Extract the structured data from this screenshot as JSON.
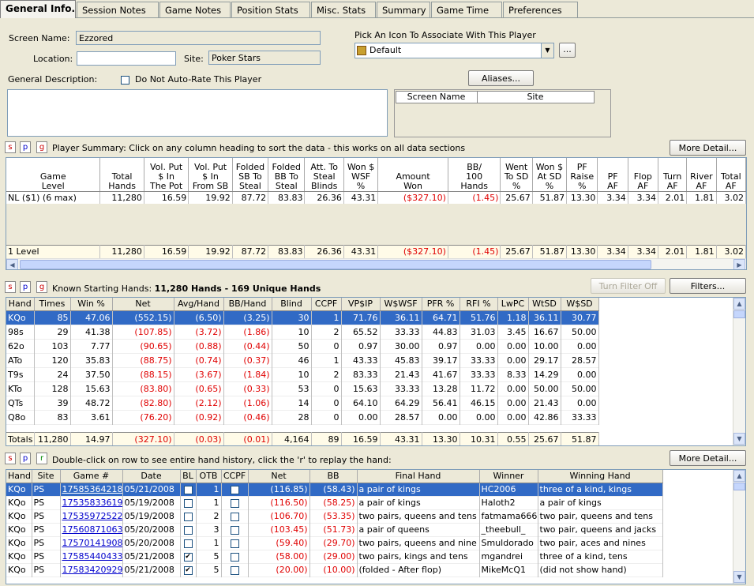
{
  "tabs": [
    {
      "label": "General Info.",
      "active": true
    },
    {
      "label": "Session Notes"
    },
    {
      "label": "Game Notes"
    },
    {
      "label": "Position Stats"
    },
    {
      "label": "Misc. Stats"
    },
    {
      "label": "Summary"
    },
    {
      "label": "Game Time"
    },
    {
      "label": "Preferences"
    }
  ],
  "form": {
    "screen_name_label": "Screen Name:",
    "screen_name": "Ezzored",
    "location_label": "Location:",
    "location": "",
    "site_label": "Site:",
    "site": "Poker Stars",
    "icon_label": "Pick An Icon To Associate With This Player",
    "icon_value": "Default",
    "icon_browse": "...",
    "desc_label": "General Description:",
    "no_autorate_label": "Do Not Auto-Rate This Player",
    "aliases_button": "Aliases...",
    "aliases_headers": [
      "Screen Name",
      "Site"
    ]
  },
  "summary": {
    "filter_s": "s",
    "filter_p": "p",
    "filter_g": "g",
    "title": "Player Summary: Click on any column heading to sort the data - this works on all data sections",
    "more_button": "More Detail...",
    "headers": [
      "Game\nLevel",
      "Total\nHands",
      "Vol. Put\n$ In\nThe Pot",
      "Vol. Put\n$ In\nFrom SB",
      "Folded\nSB To\nSteal",
      "Folded\nBB To\nSteal",
      "Att. To\nSteal\nBlinds",
      "Won $\nWSF\n%",
      "Amount\nWon",
      "BB/\n100\nHands",
      "Went\nTo SD\n%",
      "Won $\nAt SD\n%",
      "PF\nRaise\n%",
      "PF\nAF",
      "Flop\nAF",
      "Turn\nAF",
      "River\nAF",
      "Total\nAF"
    ],
    "rows": [
      [
        "NL ($1) (6 max)",
        "11,280",
        "16.59",
        "19.92",
        "87.72",
        "83.83",
        "26.36",
        "43.31",
        "($327.10)",
        "(1.45)",
        "25.67",
        "51.87",
        "13.30",
        "3.34",
        "3.34",
        "2.01",
        "1.81",
        "3.02"
      ]
    ],
    "total_row": [
      "1 Level",
      "11,280",
      "16.59",
      "19.92",
      "87.72",
      "83.83",
      "26.36",
      "43.31",
      "($327.10)",
      "(1.45)",
      "25.67",
      "51.87",
      "13.30",
      "3.34",
      "3.34",
      "2.01",
      "1.81",
      "3.02"
    ]
  },
  "hands": {
    "filter_s": "s",
    "filter_p": "p",
    "filter_g": "g",
    "title_prefix": "Known Starting Hands: ",
    "title_bold": "11,280 Hands - 169 Unique Hands",
    "turn_filter_button": "Turn Filter Off",
    "filters_button": "Filters...",
    "headers": [
      "Hand",
      "Times",
      "Win %",
      "Net",
      "Avg/Hand",
      "BB/Hand",
      "Blind",
      "CCPF",
      "VP$IP",
      "W$WSF",
      "PFR %",
      "RFI %",
      "LwPC",
      "WtSD",
      "W$SD"
    ],
    "rows": [
      [
        "KQo",
        "85",
        "47.06",
        "(552.15)",
        "(6.50)",
        "(3.25)",
        "30",
        "1",
        "71.76",
        "36.11",
        "64.71",
        "51.76",
        "1.18",
        "36.11",
        "30.77"
      ],
      [
        "98s",
        "29",
        "41.38",
        "(107.85)",
        "(3.72)",
        "(1.86)",
        "10",
        "2",
        "65.52",
        "33.33",
        "44.83",
        "31.03",
        "3.45",
        "16.67",
        "50.00"
      ],
      [
        "62o",
        "103",
        "7.77",
        "(90.65)",
        "(0.88)",
        "(0.44)",
        "50",
        "0",
        "0.97",
        "30.00",
        "0.97",
        "0.00",
        "0.00",
        "10.00",
        "0.00"
      ],
      [
        "ATo",
        "120",
        "35.83",
        "(88.75)",
        "(0.74)",
        "(0.37)",
        "46",
        "1",
        "43.33",
        "45.83",
        "39.17",
        "33.33",
        "0.00",
        "29.17",
        "28.57"
      ],
      [
        "T9s",
        "24",
        "37.50",
        "(88.15)",
        "(3.67)",
        "(1.84)",
        "10",
        "2",
        "83.33",
        "21.43",
        "41.67",
        "33.33",
        "8.33",
        "14.29",
        "0.00"
      ],
      [
        "KTo",
        "128",
        "15.63",
        "(83.80)",
        "(0.65)",
        "(0.33)",
        "53",
        "0",
        "15.63",
        "33.33",
        "13.28",
        "11.72",
        "0.00",
        "50.00",
        "50.00"
      ],
      [
        "QTs",
        "39",
        "48.72",
        "(82.80)",
        "(2.12)",
        "(1.06)",
        "14",
        "0",
        "64.10",
        "64.29",
        "56.41",
        "46.15",
        "0.00",
        "21.43",
        "0.00"
      ],
      [
        "Q8o",
        "83",
        "3.61",
        "(76.20)",
        "(0.92)",
        "(0.46)",
        "28",
        "0",
        "0.00",
        "28.57",
        "0.00",
        "0.00",
        "0.00",
        "42.86",
        "33.33"
      ]
    ],
    "total_row": [
      "Totals",
      "11,280",
      "14.97",
      "(327.10)",
      "(0.03)",
      "(0.01)",
      "4,164",
      "89",
      "16.59",
      "43.31",
      "13.30",
      "10.31",
      "0.55",
      "25.67",
      "51.87"
    ]
  },
  "history": {
    "filter_s": "s",
    "filter_p": "p",
    "filter_r": "r",
    "title": "Double-click on row to see entire hand history, click the 'r' to replay the hand:",
    "more_button": "More Detail...",
    "headers": [
      "Hand",
      "Site",
      "Game #",
      "Date",
      "BL",
      "OTB",
      "CCPF",
      "Net",
      "BB",
      "Final Hand",
      "Winner",
      "Winning Hand"
    ],
    "rows": [
      {
        "hand": "KQo",
        "site": "PS",
        "game": "17585364218",
        "date": "05/21/2008",
        "bl": false,
        "otb": "1",
        "ccpf": false,
        "net": "(116.85)",
        "bb": "(58.43)",
        "final": "a pair of kings",
        "winner": "HC2006",
        "winning": "three of a kind, kings"
      },
      {
        "hand": "KQo",
        "site": "PS",
        "game": "17535833619",
        "date": "05/19/2008",
        "bl": false,
        "otb": "1",
        "ccpf": false,
        "net": "(116.50)",
        "bb": "(58.25)",
        "final": "a pair of kings",
        "winner": "Haloth2",
        "winning": "a pair of kings"
      },
      {
        "hand": "KQo",
        "site": "PS",
        "game": "17535972522",
        "date": "05/19/2008",
        "bl": false,
        "otb": "2",
        "ccpf": false,
        "net": "(106.70)",
        "bb": "(53.35)",
        "final": "two pairs, queens and tens",
        "winner": "fatmama666",
        "winning": "two pair, queens and tens"
      },
      {
        "hand": "KQo",
        "site": "PS",
        "game": "17560871063",
        "date": "05/20/2008",
        "bl": false,
        "otb": "3",
        "ccpf": false,
        "net": "(103.45)",
        "bb": "(51.73)",
        "final": "a pair of queens",
        "winner": "_theebull_",
        "winning": "two pair, queens and jacks"
      },
      {
        "hand": "KQo",
        "site": "PS",
        "game": "17570141908",
        "date": "05/20/2008",
        "bl": false,
        "otb": "1",
        "ccpf": false,
        "net": "(59.40)",
        "bb": "(29.70)",
        "final": "two pairs, queens and nine",
        "winner": "Smuldorado",
        "winning": "two pair, aces and nines"
      },
      {
        "hand": "KQo",
        "site": "PS",
        "game": "17585440433",
        "date": "05/21/2008",
        "bl": true,
        "otb": "5",
        "ccpf": false,
        "net": "(58.00)",
        "bb": "(29.00)",
        "final": "two pairs, kings and tens",
        "winner": "mgandrei",
        "winning": "three of a kind, tens"
      },
      {
        "hand": "KQo",
        "site": "PS",
        "game": "17583420929",
        "date": "05/21/2008",
        "bl": true,
        "otb": "5",
        "ccpf": false,
        "net": "(20.00)",
        "bb": "(10.00)",
        "final": "(folded - After flop)",
        "winner": "MikeMcQ1",
        "winning": "(did not show hand)"
      }
    ]
  }
}
